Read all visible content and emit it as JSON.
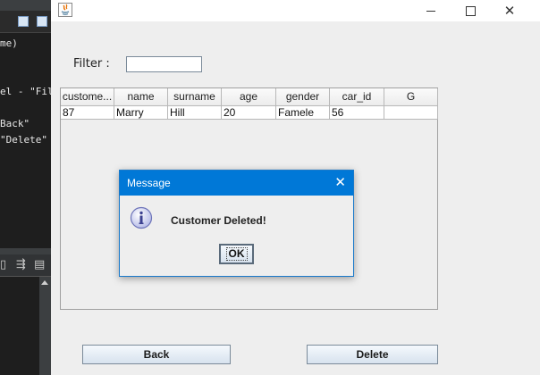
{
  "ide": {
    "lines": [
      "me)",
      "el - \"Filter :",
      "Back\"",
      "\"Delete\""
    ]
  },
  "window": {
    "filter_label": "Filter :",
    "filter_value": "",
    "table": {
      "columns": [
        "custome...",
        "name",
        "surname",
        "age",
        "gender",
        "car_id",
        "G"
      ],
      "rows": [
        [
          "87",
          "Marry",
          "Hill",
          "20",
          "Famele",
          "56",
          ""
        ]
      ]
    },
    "buttons": {
      "back": "Back",
      "delete": "Delete"
    }
  },
  "dialog": {
    "title": "Message",
    "message": "Customer Deleted!",
    "ok": "OK"
  }
}
